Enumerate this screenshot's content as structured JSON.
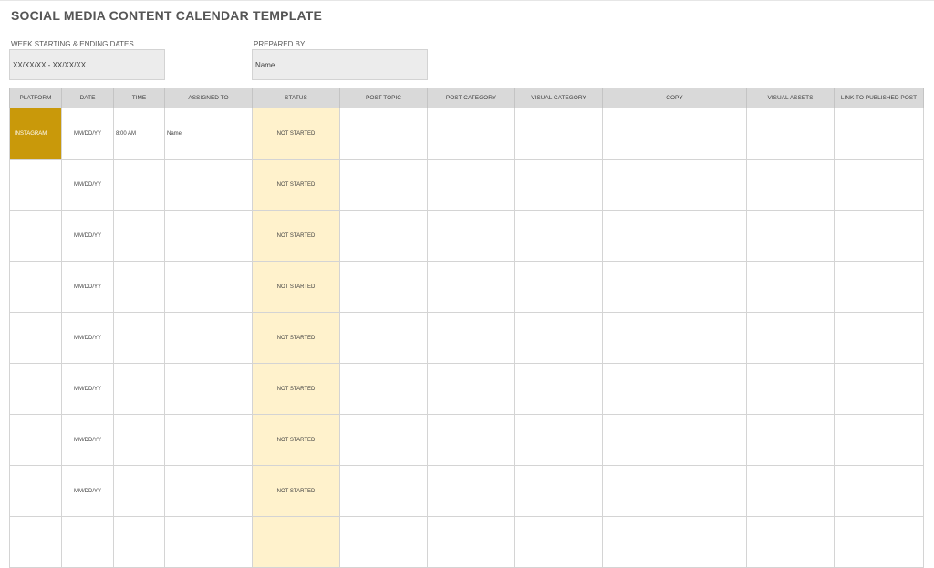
{
  "title": "SOCIAL MEDIA CONTENT CALENDAR TEMPLATE",
  "week": {
    "label": "WEEK STARTING & ENDING DATES",
    "value": "XX/XX/XX - XX/XX/XX"
  },
  "prepared": {
    "label": "PREPARED BY",
    "value": "Name"
  },
  "columns": [
    "PLATFORM",
    "DATE",
    "TIME",
    "ASSIGNED TO",
    "STATUS",
    "POST TOPIC",
    "POST CATEGORY",
    "VISUAL CATEGORY",
    "COPY",
    "VISUAL ASSETS",
    "LINK TO PUBLISHED POST"
  ],
  "rows": [
    {
      "platform": "INSTAGRAM",
      "date": "MM/DD/YY",
      "time": "8:00 AM",
      "assigned": "Name",
      "status": "NOT STARTED"
    },
    {
      "platform": "",
      "date": "MM/DD/YY",
      "time": "",
      "assigned": "",
      "status": "NOT STARTED"
    },
    {
      "platform": "",
      "date": "MM/DD/YY",
      "time": "",
      "assigned": "",
      "status": "NOT STARTED"
    },
    {
      "platform": "",
      "date": "MM/DD/YY",
      "time": "",
      "assigned": "",
      "status": "NOT STARTED"
    },
    {
      "platform": "",
      "date": "MM/DD/YY",
      "time": "",
      "assigned": "",
      "status": "NOT STARTED"
    },
    {
      "platform": "",
      "date": "MM/DD/YY",
      "time": "",
      "assigned": "",
      "status": "NOT STARTED"
    },
    {
      "platform": "",
      "date": "MM/DD/YY",
      "time": "",
      "assigned": "",
      "status": "NOT STARTED"
    },
    {
      "platform": "",
      "date": "MM/DD/YY",
      "time": "",
      "assigned": "",
      "status": "NOT STARTED"
    },
    {
      "platform": "",
      "date": "",
      "time": "",
      "assigned": "",
      "status": ""
    }
  ],
  "colors": {
    "platform_instagram": "#c9990a",
    "status_fill": "#fff2cc",
    "header_fill": "#d9d9d9",
    "field_fill": "#ececec"
  }
}
